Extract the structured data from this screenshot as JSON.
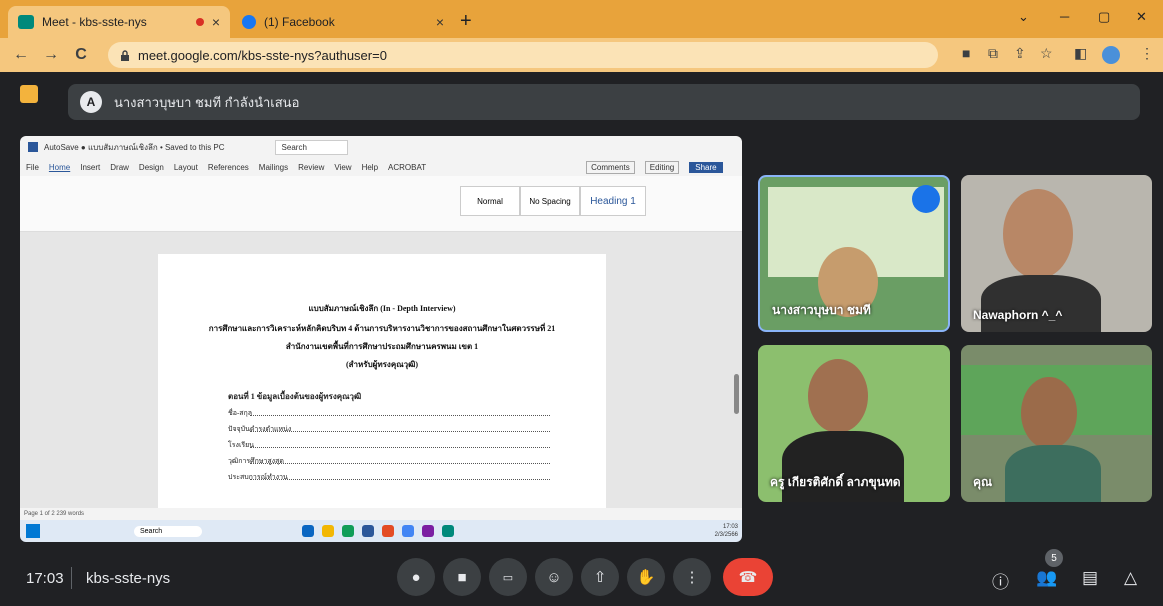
{
  "browser": {
    "tabs": [
      {
        "title": "Meet - kbs-sste-nys",
        "close": "×"
      },
      {
        "title": "(1) Facebook",
        "close": "×"
      }
    ],
    "new_tab": "+",
    "url": "meet.google.com/kbs-sste-nys?authuser=0",
    "window_controls": {
      "min": "─",
      "max": "▢",
      "close": "✕"
    },
    "nav": {
      "back": "←",
      "forward": "→",
      "reload": "C"
    }
  },
  "meet": {
    "presenter_text": "นางสาวบุษบา ชมที กำลังนำเสนอ",
    "presenter_initial": "A",
    "time": "17:03",
    "meeting_code": "kbs-sste-nys",
    "participants_count": "5",
    "tiles": [
      {
        "name": "นางสาวบุษบา ชมที"
      },
      {
        "name": "Nawaphorn ^_^"
      },
      {
        "name": "ครู เกียรติศักดิ์ ลาภขุนทด"
      },
      {
        "name": "คุณ"
      }
    ]
  },
  "shared_screen": {
    "word_title": "AutoSave  ●  แบบสัมภาษณ์เชิงลึก • Saved to this PC",
    "search": "Search",
    "ribbon_tabs": [
      "File",
      "Home",
      "Insert",
      "Draw",
      "Design",
      "Layout",
      "References",
      "Mailings",
      "Review",
      "View",
      "Help",
      "ACROBAT"
    ],
    "comments_label": "Comments",
    "editing_label": "Editing",
    "share_label": "Share",
    "styles": [
      "Normal",
      "No Spacing",
      "Heading 1"
    ],
    "doc_lines": [
      "แบบสัมภาษณ์เชิงลึก (In - Depth Interview)",
      "การศึกษาและการวิเคราะห์หลักคิดบริบท 4 ด้านการบริหารงานวิชาการของสถานศึกษาในศตวรรษที่ 21",
      "สำนักงานเขตพื้นที่การศึกษาประถมศึกษานครพนม เขต 1",
      "(สำหรับผู้ทรงคุณวุฒิ)"
    ],
    "section_title": "ตอนที่ 1 ข้อมูลเบื้องต้นของผู้ทรงคุณวุฒิ",
    "fields": [
      "ชื่อ-สกุล",
      "ปัจจุบันดำรงตำแหน่ง",
      "โรงเรียน",
      "วุฒิการศึกษาสูงสุด",
      "ประสบการณ์ทำงาน"
    ],
    "status_left": "Page 1 of 2   239 words",
    "taskbar_search": "Search",
    "taskbar_time": "17:03",
    "taskbar_date": "2/3/2566"
  }
}
